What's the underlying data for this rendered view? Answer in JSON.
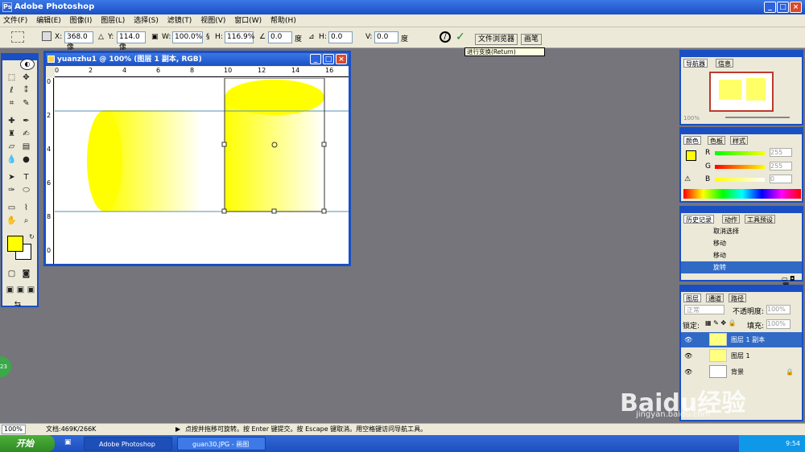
{
  "window": {
    "title": "Adobe Photoshop"
  },
  "menu": [
    "文件(F)",
    "编辑(E)",
    "图像(I)",
    "图层(L)",
    "选择(S)",
    "滤镜(T)",
    "视图(V)",
    "窗口(W)",
    "帮助(H)"
  ],
  "options": {
    "x_label": "X:",
    "x": "368.0 像",
    "y_label": "Y:",
    "y": "114.0 像",
    "w_label": "W:",
    "w": "100.0%",
    "h_label": "H:",
    "h": "116.9%",
    "angle": "0.0",
    "angle_unit": "度",
    "hskew_label": "H:",
    "hskew": "0.0",
    "vskew_label": "V:",
    "vskew": "0.0",
    "deg": "度",
    "commit_tooltip": "进行变换(Return)"
  },
  "wells": {
    "file_browser": "文件浏览器",
    "brushes": "画笔"
  },
  "document": {
    "title": "yuanzhu1 @ 100% (图层 1 副本, RGB)",
    "ruler_h": [
      "0",
      "2",
      "4",
      "6",
      "8",
      "10",
      "12",
      "14",
      "16"
    ],
    "ruler_v": [
      "0",
      "2",
      "4",
      "6",
      "8",
      "0"
    ]
  },
  "navigator": {
    "tabs": [
      "导航器",
      "信息"
    ],
    "zoom": "100%"
  },
  "color": {
    "tabs": [
      "颜色",
      "色板",
      "样式"
    ],
    "r_label": "R",
    "g_label": "G",
    "b_label": "B",
    "r": "255",
    "g": "255",
    "b": "0"
  },
  "history": {
    "tabs": [
      "历史记录",
      "动作",
      "工具预设"
    ],
    "items": [
      "取消选择",
      "移动",
      "移动",
      "旋转"
    ]
  },
  "layers": {
    "tabs": [
      "图层",
      "通道",
      "路径"
    ],
    "mode": "正常",
    "opacity_label": "不透明度:",
    "opacity": "100%",
    "lock_label": "锁定:",
    "fill_label": "填充:",
    "fill": "100%",
    "items": [
      "图层 1 副本",
      "图层 1",
      "背景"
    ]
  },
  "status": {
    "zoom": "100%",
    "doc": "文档:469K/266K",
    "hint": "点按并拖移可旋转。按 Enter 键提交。按 Escape 键取消。用空格键访问导航工具。"
  },
  "taskbar": {
    "start": "开始",
    "items": [
      "Adobe Photoshop",
      "guan30.JPG - 画图"
    ],
    "clock": "9:54"
  },
  "watermark": {
    "brand": "Baidu经验",
    "url": "jingyan.baidu.com"
  },
  "colors": {
    "accent": "#1a4fc4",
    "fg_swatch": "#ffff00",
    "workspace": "#75757b"
  }
}
